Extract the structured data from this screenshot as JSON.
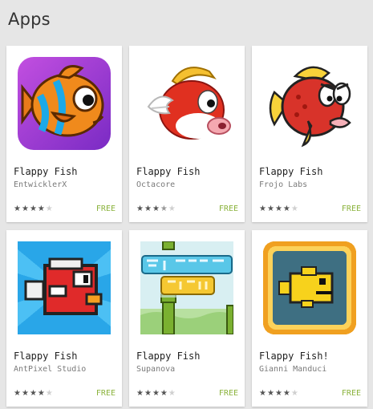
{
  "section": {
    "title": "Apps"
  },
  "apps": [
    {
      "title": "Flappy Fish",
      "developer": "EntwicklerX",
      "price": "FREE",
      "rating": 4,
      "icon": "orange-fish-icon"
    },
    {
      "title": "Flappy Fish",
      "developer": "Octacore",
      "price": "FREE",
      "rating": 3.5,
      "icon": "red-winged-fish-icon"
    },
    {
      "title": "Flappy Fish",
      "developer": "Frojo Labs",
      "price": "FREE",
      "rating": 4,
      "icon": "red-angry-fish-icon"
    },
    {
      "title": "Flappy Fish",
      "developer": "AntPixel Studio",
      "price": "FREE",
      "rating": 4,
      "icon": "pixel-red-fish-icon"
    },
    {
      "title": "Flappy Fish",
      "developer": "Supanova",
      "price": "FREE",
      "rating": 4,
      "icon": "flappy-fish-logo-icon"
    },
    {
      "title": "Flappy Fish!",
      "developer": "Gianni Manduci",
      "price": "FREE",
      "rating": 4,
      "icon": "yellow-pixel-fish-icon"
    }
  ],
  "colors": {
    "price": "#8bb33d",
    "background": "#e6e6e6"
  }
}
